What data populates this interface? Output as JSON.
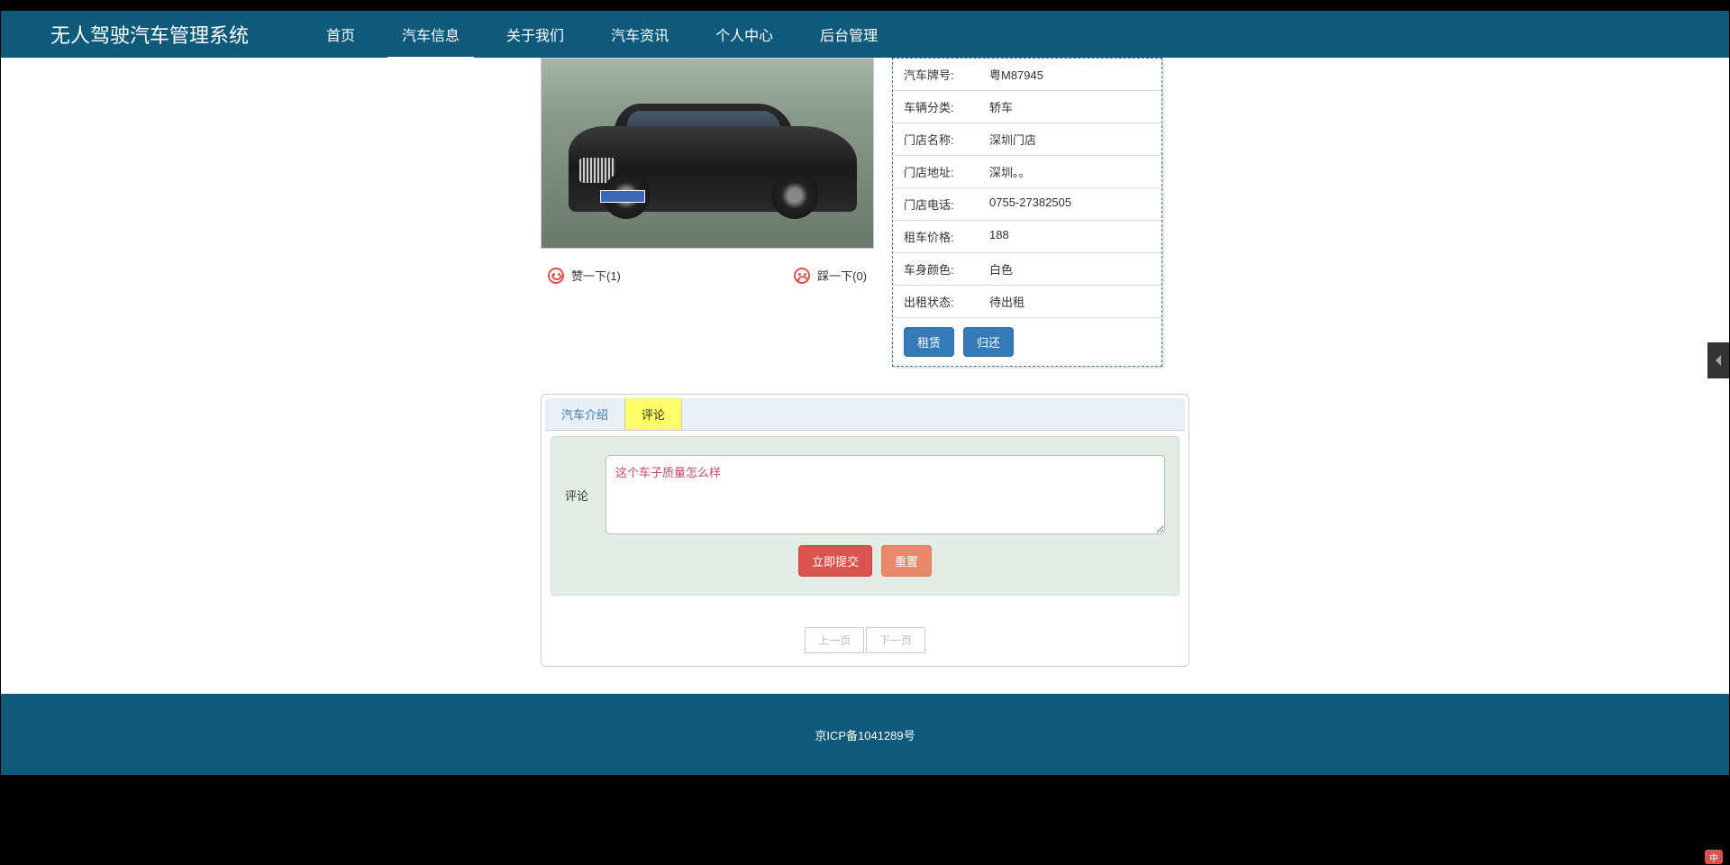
{
  "site_title": "无人驾驶汽车管理系统",
  "nav": [
    {
      "label": "首页"
    },
    {
      "label": "汽车信息",
      "active": true
    },
    {
      "label": "关于我们"
    },
    {
      "label": "汽车资讯"
    },
    {
      "label": "个人中心"
    },
    {
      "label": "后台管理"
    }
  ],
  "votes": {
    "like_label": "赞一下(1)",
    "dislike_label": "踩一下(0)"
  },
  "car_info": [
    {
      "label": "汽车牌号:",
      "value": "粤M87945"
    },
    {
      "label": "车辆分类:",
      "value": "轿车"
    },
    {
      "label": "门店名称:",
      "value": "深圳门店"
    },
    {
      "label": "门店地址:",
      "value": "深圳。。"
    },
    {
      "label": "门店电话:",
      "value": "0755-27382505"
    },
    {
      "label": "租车价格:",
      "value": "188"
    },
    {
      "label": "车身颜色:",
      "value": "白色"
    },
    {
      "label": "出租状态:",
      "value": "待出租"
    }
  ],
  "actions": {
    "rent": "租赁",
    "return": "归还"
  },
  "tabs": {
    "intro": "汽车介绍",
    "comment": "评论"
  },
  "comment_section": {
    "label": "评论",
    "value": "这个车子质量怎么样",
    "submit": "立即提交",
    "reset": "重置"
  },
  "pagination": {
    "prev": "上一页",
    "next": "下一页"
  },
  "footer": "京ICP备1041289号",
  "ime": "中"
}
